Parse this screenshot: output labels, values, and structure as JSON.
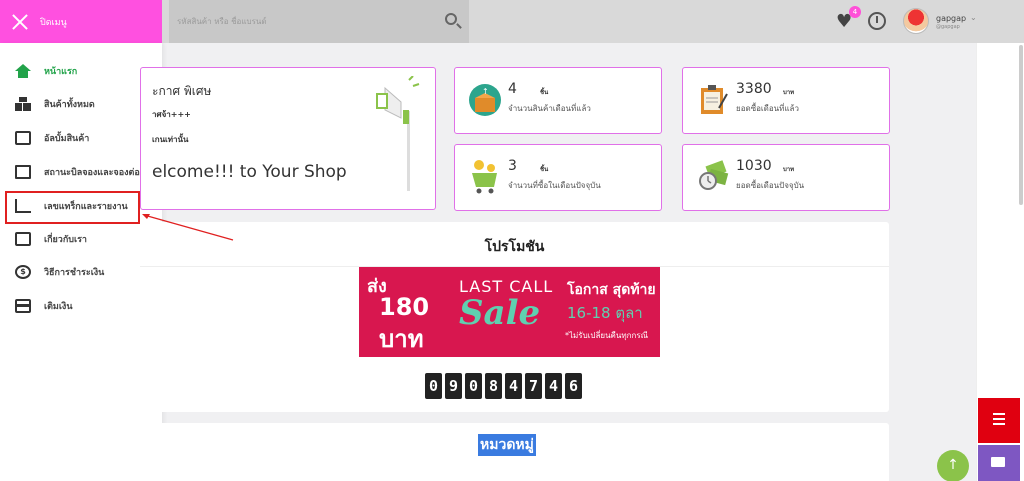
{
  "topbar": {
    "menu_label": "ปิดเมนู",
    "search_placeholder": "รหัสสินค้า หรือ ชื่อแบรนด์",
    "wishlist_count": "4",
    "username": "gapgap",
    "user_sub": "@gapgap"
  },
  "sidebar": {
    "items": [
      {
        "label": "หน้าแรก",
        "icon": "home-icon",
        "active": true
      },
      {
        "label": "สินค้าทั้งหมด",
        "icon": "boxes-icon"
      },
      {
        "label": "อัลบั้มสินค้า",
        "icon": "album-icon"
      },
      {
        "label": "สถานะบิลจองและจองต่อ",
        "icon": "copy-icon"
      },
      {
        "label": "เลขแทร็กและรายงาน",
        "icon": "chart-icon"
      },
      {
        "label": "เกี่ยวกับเรา",
        "icon": "id-card-icon"
      },
      {
        "label": "วิธีการชำระเงิน",
        "icon": "coin-icon"
      },
      {
        "label": "เติมเงิน",
        "icon": "credit-card-icon"
      }
    ]
  },
  "announcement": {
    "title": "ะกาศ พิเศษ",
    "line1": "าศจ้า+++",
    "line2": "เกนเท่านั้น",
    "welcome": "elcome!!!  to Your Shop"
  },
  "stats": [
    {
      "value": "4",
      "unit": "ชิ้น",
      "label": "จำนวนสินค้าเดือนที่แล้ว",
      "icon": "box-icon"
    },
    {
      "value": "3380",
      "unit": "บาท",
      "label": "ยอดซื้อเดือนที่แล้ว",
      "icon": "clipboard-icon"
    },
    {
      "value": "3",
      "unit": "ชิ้น",
      "label": "จำนวนที่ซื้อในเดือนปัจจุบัน",
      "icon": "cart-icon"
    },
    {
      "value": "1030",
      "unit": "บาท",
      "label": "ยอดซื้อเดือนปัจจุบัน",
      "icon": "money-icon"
    }
  ],
  "promo": {
    "title": "โปรโมชัน",
    "banner": {
      "song": "ส่ง",
      "amount": "180",
      "baht": "บาท",
      "last_call": "LAST CALL",
      "sale": "Sale",
      "chance": "โอกาส สุดท้าย",
      "dates": "16-18 ตุลา",
      "note": "*ไม่รับเปลี่ยนคืนทุกกรณี"
    },
    "counter": [
      "0",
      "9",
      "0",
      "8",
      "4",
      "7",
      "4",
      "6"
    ]
  },
  "category": {
    "title": "หมวดหมู่"
  },
  "colors": {
    "brand": "#ff50e0",
    "active": "#22a34a",
    "highlight": "#e02020"
  }
}
